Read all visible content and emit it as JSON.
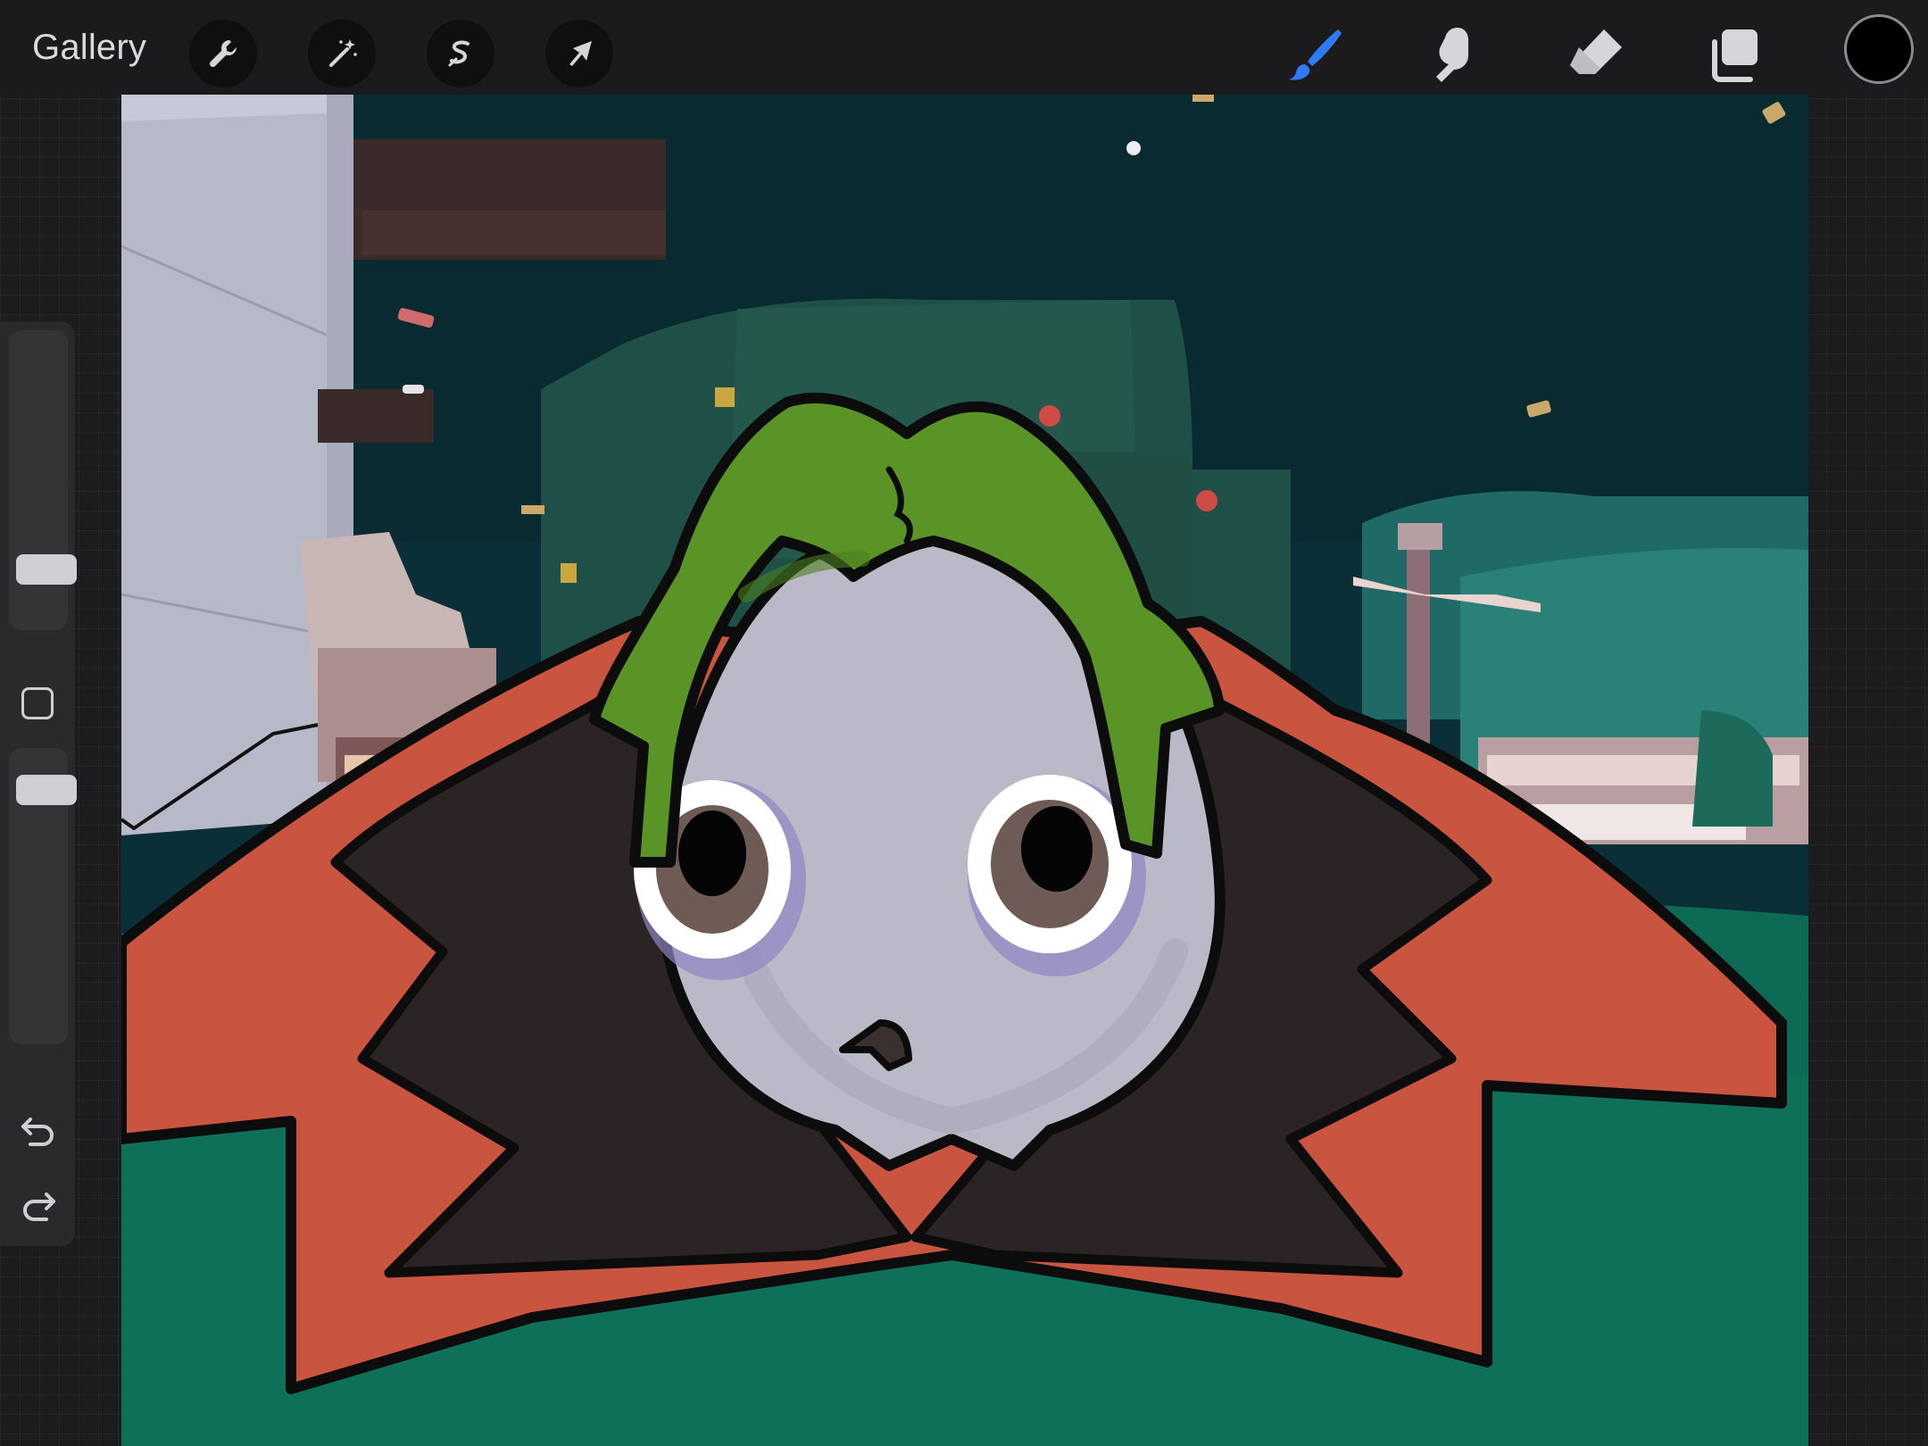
{
  "toolbar": {
    "gallery_label": "Gallery",
    "left_tools": [
      {
        "name": "actions",
        "icon": "wrench-icon"
      },
      {
        "name": "adjustments",
        "icon": "magic-wand-icon"
      },
      {
        "name": "selection",
        "icon": "selection-s-icon"
      },
      {
        "name": "transform",
        "icon": "arrow-cursor-icon"
      }
    ],
    "right_tools": [
      {
        "name": "brush",
        "icon": "brush-icon",
        "active": true,
        "color": "#2f7bf6"
      },
      {
        "name": "smudge",
        "icon": "smudge-finger-icon",
        "active": false
      },
      {
        "name": "eraser",
        "icon": "eraser-icon",
        "active": false
      },
      {
        "name": "layers",
        "icon": "layers-icon",
        "active": false
      }
    ],
    "current_color": "#000000"
  },
  "sidebar": {
    "brush_size_level": 0.79,
    "opacity_level": 0.86,
    "modify_button_icon": "square-icon",
    "undo_icon": "undo-icon",
    "redo_icon": "redo-icon"
  },
  "canvas": {
    "artwork": "illustration-canvas"
  }
}
